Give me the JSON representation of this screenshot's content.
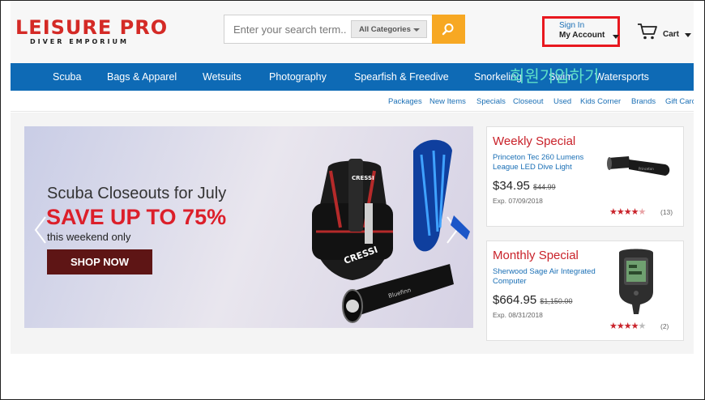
{
  "header": {
    "logo_main": "LEISURE PRO",
    "logo_sub": "DIVER EMPORIUM",
    "search_placeholder": "Enter your search term..",
    "category_label": "All Categories",
    "account_sign_in": "Sign In",
    "account_label": "My Account",
    "cart_label": "Cart"
  },
  "nav": {
    "items": [
      "Scuba",
      "Bags & Apparel",
      "Wetsuits",
      "Photography",
      "Spearfish & Freedive",
      "Snorkeling",
      "Swim",
      "Watersports"
    ],
    "overlay_text": "회원가입하기"
  },
  "sublinks": [
    "Packages",
    "New Items",
    "Specials",
    "Closeout",
    "Used",
    "Kids Corner",
    "Brands",
    "Gift Cards"
  ],
  "banner": {
    "line1": "Scuba Closeouts for July",
    "line2": "SAVE UP TO 75%",
    "line3": "this weekend only",
    "button": "SHOP NOW",
    "product_labels": [
      "CRESSI",
      "CRESSI",
      "Bluefinn"
    ]
  },
  "weekly": {
    "title": "Weekly Special",
    "product": "Princeton Tec 260 Lumens League LED Dive Light",
    "price": "$34.95",
    "old_price": "$44.99",
    "expires": "Exp. 07/09/2018",
    "rating": 4.5,
    "reviews": "(13)"
  },
  "monthly": {
    "title": "Monthly Special",
    "product": "Sherwood Sage Air Integrated Computer",
    "price": "$664.95",
    "old_price": "$1,150.00",
    "expires": "Exp. 08/31/2018",
    "rating": 4,
    "reviews": "(2)"
  },
  "colors": {
    "brand_red": "#d42a26",
    "nav_blue": "#0e6ab5",
    "search_orange": "#f7a823",
    "link_blue": "#1a6fb5",
    "highlight_red": "#e8181f"
  },
  "icons": {
    "search": "search-icon",
    "cart": "cart-icon",
    "prev": "chevron-left-icon",
    "next": "chevron-right-icon"
  }
}
